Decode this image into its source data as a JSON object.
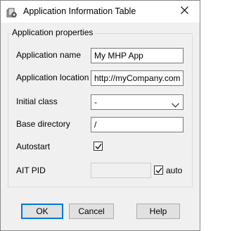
{
  "window": {
    "title": "Application Information Table",
    "close_icon": "close-icon",
    "app_icon": "app-settings-icon"
  },
  "group": {
    "title": "Application properties",
    "fields": {
      "app_name": {
        "label": "Application name",
        "value": "My MHP App"
      },
      "app_location": {
        "label": "Application location",
        "value": "http://myCompany.com"
      },
      "initial_class": {
        "label": "Initial class",
        "value": "-"
      },
      "base_directory": {
        "label": "Base directory",
        "value": "/"
      },
      "autostart": {
        "label": "Autostart",
        "checked": true
      },
      "ait_pid": {
        "label": "AIT PID",
        "value": "",
        "auto_label": "auto",
        "auto_checked": true
      }
    }
  },
  "buttons": {
    "ok": "OK",
    "cancel": "Cancel",
    "help": "Help"
  },
  "colors": {
    "accent": "#0078d7",
    "dialog_bg": "#f0f0f0"
  }
}
